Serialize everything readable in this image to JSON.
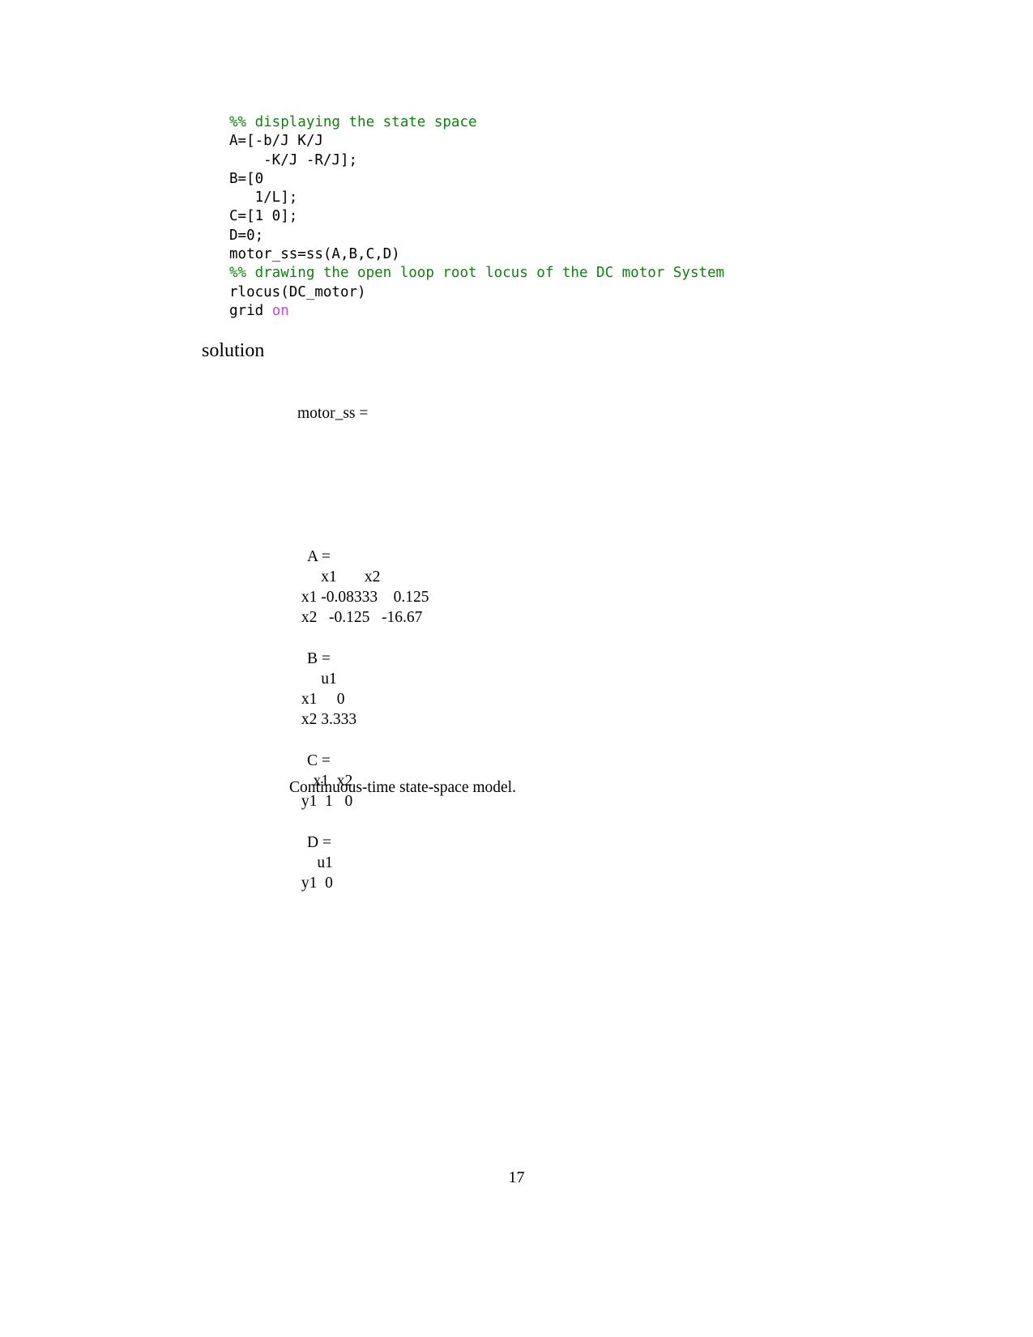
{
  "document": {
    "page_number": "17",
    "code_block": {
      "language": "matlab",
      "colors": {
        "comment": "#108010",
        "keyword": "#c14ad6",
        "plain": "#000000"
      },
      "lines": [
        [
          {
            "t": "%% displaying the state space",
            "c": "comment"
          }
        ],
        [
          {
            "t": "A=[-b/J K/J",
            "c": "plain"
          }
        ],
        [
          {
            "t": "    -K/J -R/J];",
            "c": "plain"
          }
        ],
        [
          {
            "t": "B=[0",
            "c": "plain"
          }
        ],
        [
          {
            "t": "   1/L];",
            "c": "plain"
          }
        ],
        [
          {
            "t": "C=[1 0];",
            "c": "plain"
          }
        ],
        [
          {
            "t": "D=0;",
            "c": "plain"
          }
        ],
        [
          {
            "t": "motor_ss=ss(A,B,C,D)",
            "c": "plain"
          }
        ],
        [
          {
            "t": "%% drawing the open loop root locus of the DC motor System",
            "c": "comment"
          }
        ],
        [
          {
            "t": "rlocus(DC_motor)",
            "c": "plain"
          }
        ],
        [
          {
            "t": "grid ",
            "c": "plain"
          },
          {
            "t": "on",
            "c": "keyword"
          }
        ]
      ]
    },
    "solution_heading": "solution",
    "console_output": {
      "result_name": "motor_ss =",
      "matrices": [
        {
          "name": "A =",
          "col_header": "      x1       x2",
          "rows": [
            " x1 -0.08333    0.125",
            " x2   -0.125   -16.67"
          ]
        },
        {
          "name": "B =",
          "col_header": "      u1",
          "rows": [
            " x1     0",
            " x2 3.333"
          ]
        },
        {
          "name": "C =",
          "col_header": "    x1  x2",
          "rows": [
            " y1  1   0"
          ]
        },
        {
          "name": "D =",
          "col_header": "     u1",
          "rows": [
            " y1  0"
          ]
        }
      ],
      "final_note": "Continuous-time state-space model."
    }
  }
}
